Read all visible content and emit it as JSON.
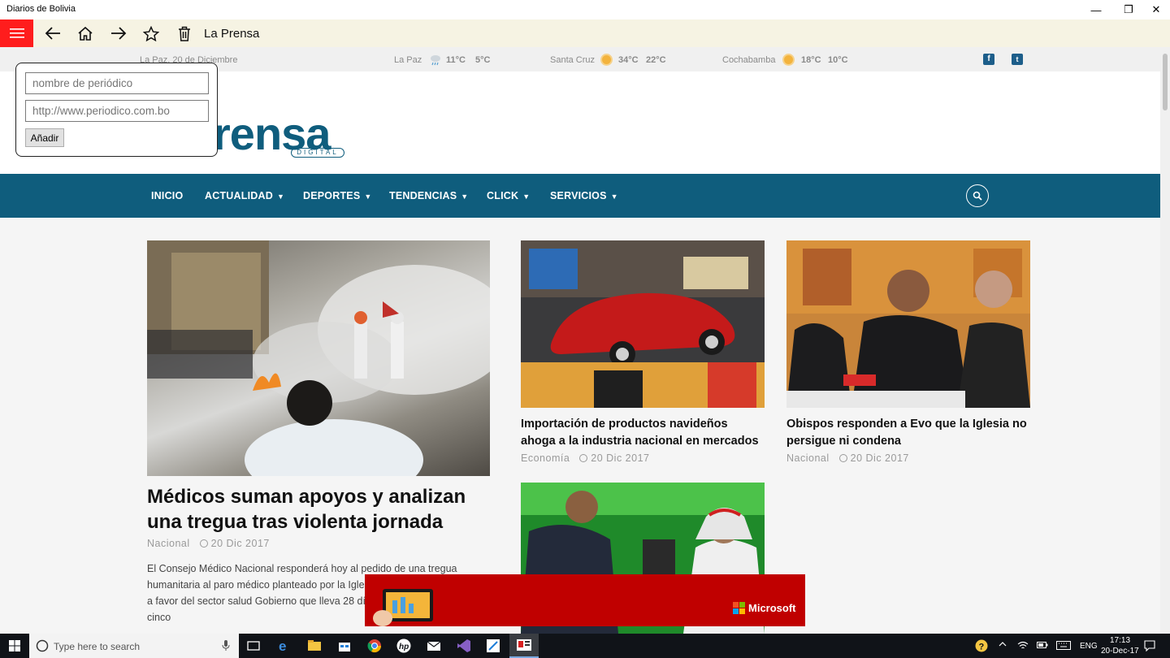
{
  "window": {
    "title": "Diarios de Bolivia",
    "minimize_glyph": "—",
    "restore_glyph": "❐",
    "close_glyph": "✕"
  },
  "toolbar": {
    "app_title": "La Prensa",
    "icons": [
      "menu-icon",
      "back-icon",
      "home-icon",
      "forward-icon",
      "star-icon",
      "trash-icon"
    ]
  },
  "popup": {
    "name_placeholder": "nombre de periódico",
    "url_placeholder": "http://www.periodico.com.bo",
    "add_label": "Añadir"
  },
  "site": {
    "date": "La Paz, 20 de Diciembre",
    "weather": [
      {
        "city": "La Paz",
        "high": "11°C",
        "low": "5°C"
      },
      {
        "city": "Santa Cruz",
        "high": "34°C",
        "low": "22°C"
      },
      {
        "city": "Cochabamba",
        "high": "18°C",
        "low": "10°C"
      }
    ],
    "logo_text": "rensa",
    "logo_sub": "DIGITAL",
    "nav": [
      "INICIO",
      "ACTUALIDAD",
      "DEPORTES",
      "TENDENCIAS",
      "CLICK",
      "SERVICIOS"
    ],
    "colors": {
      "brand": "#0f5d7d",
      "menu_red": "#ff1d1d",
      "ad_red": "#c00000"
    }
  },
  "articles": {
    "main": {
      "headline": "Médicos suman apoyos y analizan una tregua tras violenta jornada",
      "category": "Nacional",
      "date": "20 Dic 2017",
      "excerpt": "El Consejo Médico Nacional responderá hoy al pedido de una tregua humanitaria al paro médico planteado por la Igles sectores se pronunciaron a favor del sector salud Gobierno que lleva 28 días afectando la atención cinco"
    },
    "second": {
      "headline": "Importación de productos navideños ahoga a la industria nacional en mercados",
      "category": "Economía",
      "date": "20 Dic 2017"
    },
    "third": {
      "headline": "Obispos responden a Evo que la Iglesia no persigue ni condena",
      "category": "Nacional",
      "date": "20 Dic 2017"
    }
  },
  "ad": {
    "brand": "Microsoft"
  },
  "taskbar": {
    "search_placeholder": "Type here to search",
    "lang": "ENG",
    "time": "17:13",
    "date": "20-Dec-17"
  }
}
